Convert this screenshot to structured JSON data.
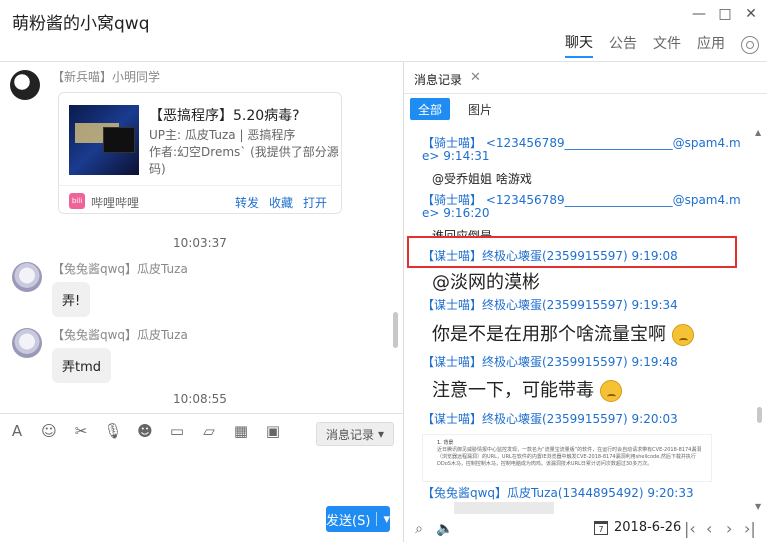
{
  "window": {
    "title": "萌粉酱的小窝qwq",
    "nav_tabs": [
      "聊天",
      "公告",
      "文件",
      "应用"
    ],
    "active_tab": "聊天"
  },
  "chat": {
    "messages": [
      {
        "sender": "【新兵喵】小明同学"
      },
      {
        "sender": "【兔兔酱qwq】瓜皮Tuza",
        "text": "弄!"
      },
      {
        "sender": "【兔兔酱qwq】瓜皮Tuza",
        "text": "弄tmd"
      }
    ],
    "card": {
      "title": "【恶搞程序】5.20病毒?",
      "uploader": "UP主: 瓜皮Tuza | 恶搞程序",
      "author": "作者:幻空Drems` (我提供了部分源码)",
      "app_name": "哔哩哔哩",
      "logo_text": "bili",
      "actions": [
        "转发",
        "收藏",
        "打开"
      ]
    },
    "timestamps": [
      "10:03:37",
      "10:08:55"
    ]
  },
  "input": {
    "history_button": "消息记录",
    "send_button": "发送(S)"
  },
  "history": {
    "tab_label": "消息记录",
    "filters": [
      "全部",
      "图片"
    ],
    "entries": [
      {
        "header": "【骑士喵】  <123456789__________________@spam4.m",
        "header2": "e> 9:14:31",
        "text": "@受乔姐姐 啥游戏"
      },
      {
        "header": "【骑士喵】  <123456789__________________@spam4.m",
        "header2": "e> 9:16:20",
        "text": "谁回应倒是"
      },
      {
        "header": "【谋士喵】终极心壊蛋(2359915597) 9:19:08",
        "text": "@淡网的漠彬"
      },
      {
        "header": "【谋士喵】终极心壊蛋(2359915597) 9:19:34",
        "text": "你是不是在用那个啥流量宝啊"
      },
      {
        "header": "【谋士喵】终极心壊蛋(2359915597) 9:19:48",
        "text": "注意一下，可能带毒"
      },
      {
        "header": "【谋士喵】终极心壊蛋(2359915597) 9:20:03"
      },
      {
        "header": "【兔兔酱qwq】瓜皮Tuza(1344895492) 9:20:33"
      }
    ],
    "doc_image": {
      "heading": "1. 背景",
      "text": "近日腾讯御见威胁情报中心监控发现，一款名为“流量宝流量版”的软件，在运行时会自动请求带有CVE-2018-8174漏洞（浏览器远程漏洞）的URL，URL在软件的内置IE浏览器中触发CVE-2018-8174漏洞利用shellcode,然后下载并执行DDoS木马，控制控制木马，控制电脑成为肉鸡。该漏洞技术URL日累计访问次数超过30多万次。"
    },
    "date": "2018-6-26",
    "calendar_day": "7"
  },
  "colors": {
    "accent": "#1e8cf2",
    "link": "#1e6fcf",
    "highlight_box": "#e03030"
  }
}
